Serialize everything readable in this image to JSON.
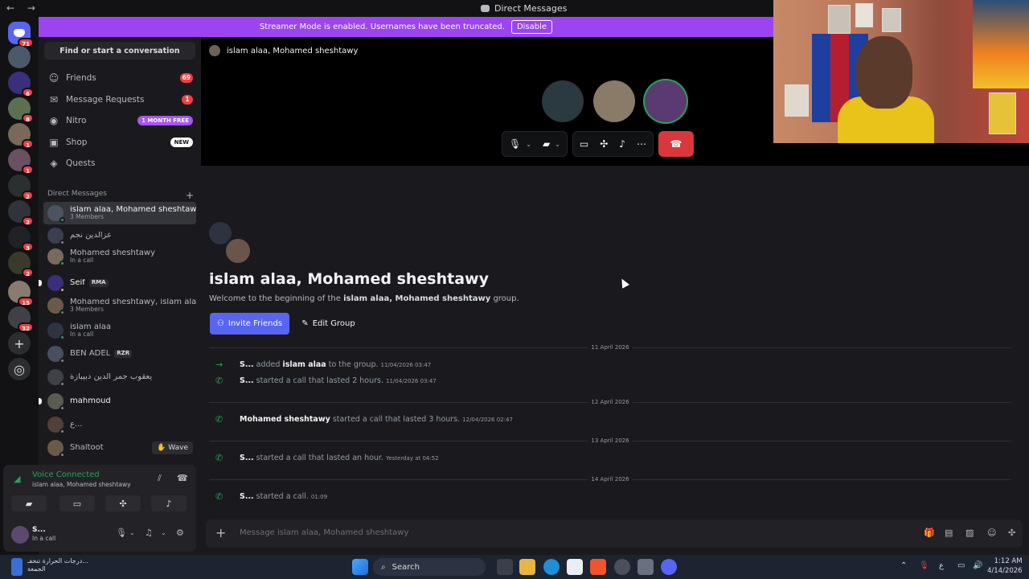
{
  "window": {
    "title": "Direct Messages",
    "nav_arrows": "← →"
  },
  "banner": {
    "text": "Streamer Mode is enabled. Usernames have been truncated.",
    "button": "Disable"
  },
  "servers": [
    {
      "badge": "71"
    },
    {
      "badge": ""
    },
    {
      "badge": "6"
    },
    {
      "badge": "8"
    },
    {
      "badge": "1"
    },
    {
      "badge": "1"
    },
    {
      "badge": "2"
    },
    {
      "badge": "2"
    },
    {
      "badge": "3"
    },
    {
      "badge": "2"
    },
    {
      "badge": "15"
    },
    {
      "badge": "32"
    }
  ],
  "sidebar": {
    "search": "Find or start a conversation",
    "nav": [
      {
        "label": "Friends",
        "count": "69",
        "icon": "friends-icon"
      },
      {
        "label": "Message Requests",
        "count": "1",
        "icon": "mail-icon"
      },
      {
        "label": "Nitro",
        "pill": "1 MONTH FREE",
        "icon": "nitro-icon"
      },
      {
        "label": "Shop",
        "pill": "NEW",
        "icon": "shop-icon"
      },
      {
        "label": "Quests",
        "icon": "quests-icon"
      }
    ],
    "dm_header": "Direct Messages",
    "dms": [
      {
        "name": "islam alaa, Mohamed sheshtawy",
        "sub": "3 Members"
      },
      {
        "name": "عزالدين نجم",
        "sub": ""
      },
      {
        "name": "Mohamed sheshtawy",
        "sub": "In a call"
      },
      {
        "name": "Seif",
        "tag": "RMA"
      },
      {
        "name": "Mohamed sheshtawy, islam alaa",
        "sub": "3 Members"
      },
      {
        "name": "islam alaa",
        "sub": "In a call"
      },
      {
        "name": "BEN ADEL",
        "tag": "RZR"
      },
      {
        "name": "يعقوب جمر الدين دبيبازة",
        "sub": ""
      },
      {
        "name": "mahmoud",
        "sub": ""
      },
      {
        "name": "ع...",
        "sub": ""
      },
      {
        "name": "Shaltoot",
        "wave": "Wave"
      }
    ]
  },
  "voice": {
    "title": "Voice Connected",
    "channel": "islam alaa, Mohamed sheshtawy"
  },
  "user": {
    "name": "S...",
    "status": "In a call"
  },
  "call": {
    "title": "islam alaa, Mohamed sheshtawy"
  },
  "chat": {
    "title": "islam alaa, Mohamed sheshtawy",
    "welcome_pre": "Welcome to the beginning of the",
    "welcome_group": "islam alaa, Mohamed sheshtawy",
    "welcome_post": "group.",
    "invite": "Invite Friends",
    "edit": "Edit Group",
    "dividers": [
      "11 April 2026",
      "12 April 2026",
      "13 April 2026",
      "14 April 2026"
    ],
    "messages": [
      {
        "who": "S...",
        "text1": "added",
        "emph": "islam alaa",
        "text2": "to the group.",
        "time": "11/04/2026 03:47"
      },
      {
        "who": "S...",
        "text1": "started a call that lasted 2 hours.",
        "time": "11/04/2026 03:47"
      },
      {
        "who": "Mohamed sheshtawy",
        "text1": "started a call that lasted 3 hours.",
        "time": "12/04/2026 02:47"
      },
      {
        "who": "S...",
        "text1": "started a call that lasted an hour.",
        "time": "Yesterday at 04:52"
      },
      {
        "who": "S...",
        "text1": "started a call.",
        "time": "01:09"
      }
    ],
    "composer_placeholder": "Message islam alaa, Mohamed sheshtawy"
  },
  "taskbar": {
    "weather_line1": "درجات الحرارة تنخفـ...",
    "weather_line2": "الجمعة",
    "search": "Search",
    "lang": "ع",
    "time": "1:12 AM",
    "date": "4/14/2026"
  },
  "colors": {
    "blurple": "#5865f2",
    "banner": "#9b44f0",
    "green": "#23a55a",
    "red": "#da373c"
  }
}
